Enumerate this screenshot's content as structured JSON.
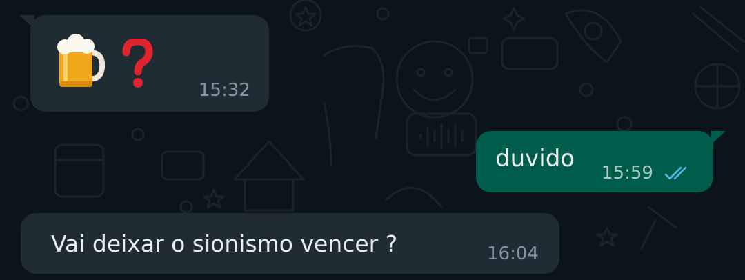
{
  "theme": {
    "background": "#0b141a",
    "incoming_bubble": "#202c33",
    "outgoing_bubble": "#005c4b",
    "text": "#e9edef",
    "meta_text": "#8696a0",
    "read_tick": "#53bdeb"
  },
  "messages": [
    {
      "direction": "incoming",
      "content_icons": [
        "beer-mug-icon",
        "red-question-mark-icon"
      ],
      "time": "15:32"
    },
    {
      "direction": "outgoing",
      "text": "duvido",
      "time": "15:59",
      "status_icon": "double-check-read-icon"
    },
    {
      "direction": "incoming",
      "text": "Vai deixar o sionismo vencer ?",
      "time": "16:04"
    }
  ]
}
